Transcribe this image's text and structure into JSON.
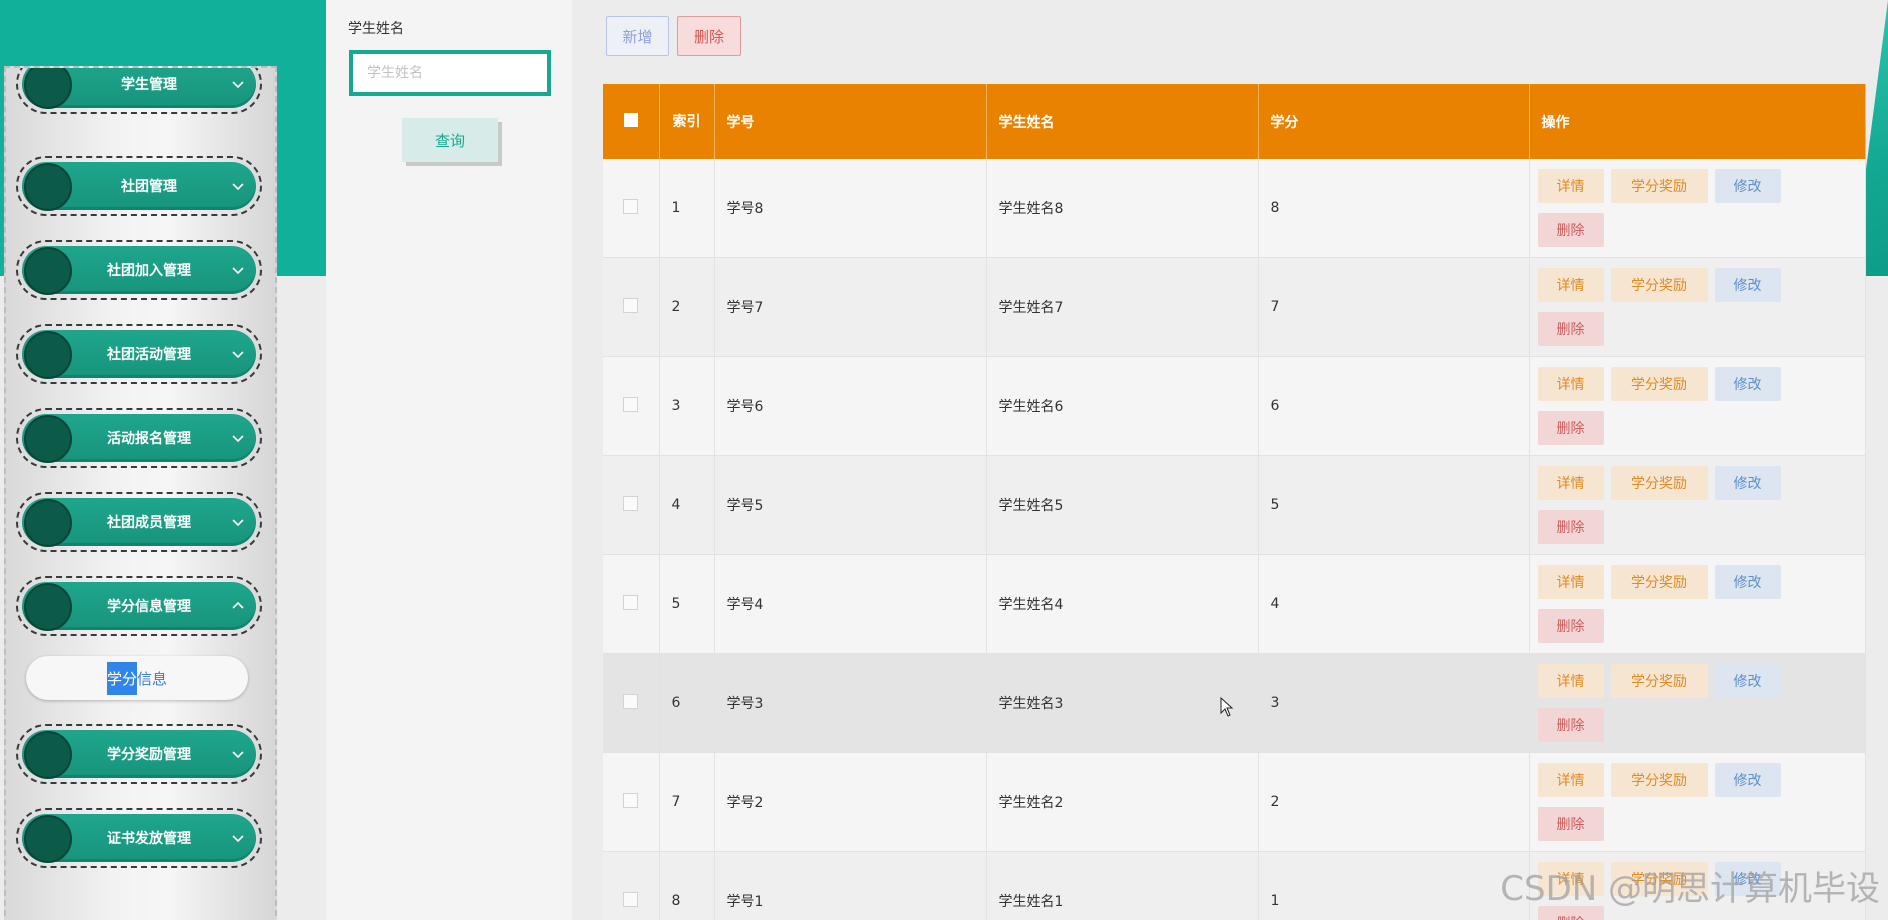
{
  "sidebar": {
    "items": [
      {
        "label": "学生管理",
        "chevron": "down"
      },
      {
        "label": "社团管理",
        "chevron": "down"
      },
      {
        "label": "社团加入管理",
        "chevron": "down"
      },
      {
        "label": "社团活动管理",
        "chevron": "down"
      },
      {
        "label": "活动报名管理",
        "chevron": "down"
      },
      {
        "label": "社团成员管理",
        "chevron": "down"
      },
      {
        "label": "学分信息管理",
        "chevron": "up"
      },
      {
        "label": "学分奖励管理",
        "chevron": "down"
      },
      {
        "label": "证书发放管理",
        "chevron": "down"
      }
    ],
    "submenu": {
      "highlight": "学分",
      "rest": "信息"
    }
  },
  "search": {
    "label": "学生姓名",
    "placeholder": "学生姓名",
    "value": "",
    "button": "查询"
  },
  "toolbar": {
    "add_label": "新增",
    "delete_label": "删除"
  },
  "table": {
    "headers": {
      "index": "索引",
      "student_no": "学号",
      "student_name": "学生姓名",
      "credit": "学分",
      "actions": "操作"
    },
    "rows": [
      {
        "index": "1",
        "student_no": "学号8",
        "student_name": "学生姓名8",
        "credit": "8"
      },
      {
        "index": "2",
        "student_no": "学号7",
        "student_name": "学生姓名7",
        "credit": "7"
      },
      {
        "index": "3",
        "student_no": "学号6",
        "student_name": "学生姓名6",
        "credit": "6"
      },
      {
        "index": "4",
        "student_no": "学号5",
        "student_name": "学生姓名5",
        "credit": "5"
      },
      {
        "index": "5",
        "student_no": "学号4",
        "student_name": "学生姓名4",
        "credit": "4"
      },
      {
        "index": "6",
        "student_no": "学号3",
        "student_name": "学生姓名3",
        "credit": "3"
      },
      {
        "index": "7",
        "student_no": "学号2",
        "student_name": "学生姓名2",
        "credit": "2"
      },
      {
        "index": "8",
        "student_no": "学号1",
        "student_name": "学生姓名1",
        "credit": "1"
      }
    ],
    "row_actions": {
      "detail": "详情",
      "award": "学分奖励",
      "edit": "修改",
      "delete": "删除"
    }
  },
  "watermark": "CSDN @明思计算机毕设",
  "colors": {
    "teal": "#11b09a",
    "header_orange": "#e98200",
    "menu_green": "#1ea68c"
  }
}
